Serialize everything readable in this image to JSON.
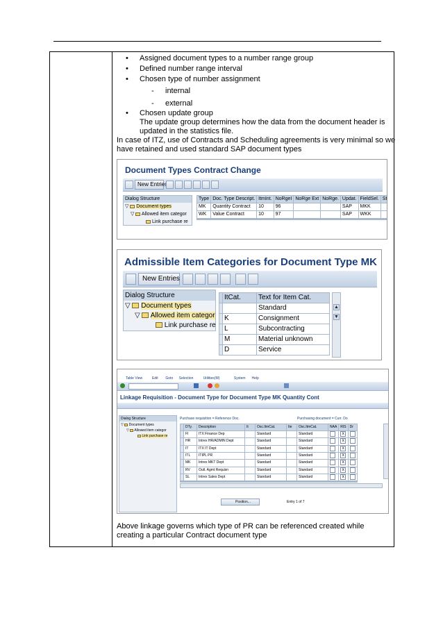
{
  "doc": {
    "bullets": [
      "Assigned document types to a number range group",
      "Defined number range interval",
      "Chosen type of number assignment"
    ],
    "dashes": [
      "internal",
      "external"
    ],
    "bullet4": "Chosen update group",
    "bullet4_line2": "The update group determines how the data from the document header is",
    "bullet4_line3": "updated in the statistics file.",
    "para1_line1": "In case of ITZ, use of Contracts and Scheduling agreements is very minimal so we",
    "para1_line2": "have  retained and used standard SAP document types",
    "footer_line1": "Above linkage governs which type of PR can be referenced created   while",
    "footer_line2": "creating a particular Contract  document type",
    "bullet_glyph": "•",
    "dash_glyph": "-"
  },
  "shot1": {
    "title": "Document Types Contract Change",
    "new_entries": "New Entries",
    "panel_title": "Dialog Structure",
    "tree": [
      "Document types",
      "Allowed item categor",
      "Link purchase re"
    ],
    "columns": [
      "Type",
      "Doc. Type Descript.",
      "ItmInt.",
      "NoRgeI",
      "NoRge Ext",
      "NoRge.",
      "Updat.",
      "FieldSel.",
      "StImI",
      "S"
    ],
    "rows": [
      [
        "MK",
        "Quantity Contract",
        "10",
        "96",
        "",
        "",
        "SAP",
        "MKK",
        "",
        ""
      ],
      [
        "WK",
        "Value Contract",
        "10",
        "97",
        "",
        "",
        "SAP",
        "WKK",
        "",
        ""
      ]
    ]
  },
  "shot2": {
    "title": "Admissible Item Categories for Document Type MK",
    "new_entries": "New Entries",
    "panel_title": "Dialog Structure",
    "tree": [
      "Document types",
      "Allowed item categor",
      "Link purchase re"
    ],
    "columns": [
      "ItCat.",
      "Text for Item Cat."
    ],
    "rows": [
      [
        "",
        "Standard"
      ],
      [
        "K",
        "Consignment"
      ],
      [
        "L",
        "Subcontracting"
      ],
      [
        "M",
        "Material unknown"
      ],
      [
        "D",
        "Service"
      ]
    ]
  },
  "shot3": {
    "menu": [
      "Table View",
      "Edit",
      "Goto",
      "Selection",
      "Utilities(M)",
      "System",
      "Help"
    ],
    "title": "Linkage Requisition - Document Type for Document Type MK Quantity Cont",
    "panel_title": "Dialog Structure",
    "tree": [
      "Document types",
      "Allowed item categor",
      "Link purchase re"
    ],
    "section_left": "Purchase requisition = Reference Doc.",
    "section_right": "Purchasing document = Curr. Do",
    "columns": [
      "DTy.",
      "Description",
      "It",
      "Osc.ItmCat.",
      "Ite",
      "Osc.ItmCat.",
      "NAA",
      "RIS",
      "Dr"
    ],
    "rows": [
      [
        "FI",
        "ITX Finance Dep",
        "",
        "Standard",
        "",
        "Standard",
        "",
        "x",
        ""
      ],
      [
        "HR",
        "Intrex HR/ADMIN Dept",
        "",
        "Standard",
        "",
        "Standard",
        "",
        "x",
        ""
      ],
      [
        "IT",
        "ITX IT Dept",
        "",
        "Standard",
        "",
        "Standard",
        "",
        "x",
        ""
      ],
      [
        "ITL",
        "ITIPL PR",
        "",
        "Standard",
        "",
        "Standard",
        "",
        "x",
        ""
      ],
      [
        "MK",
        "Intrex MKT Dept",
        "",
        "Standard",
        "",
        "Standard",
        "",
        "x",
        ""
      ],
      [
        "RV",
        "Outl. Agmt Requisn",
        "",
        "Standard",
        "",
        "Standard",
        "",
        "x",
        ""
      ],
      [
        "SL",
        "Intrex Sales Dept",
        "",
        "Standard",
        "",
        "Standard",
        "",
        "x",
        ""
      ]
    ],
    "position_button": "Position...",
    "entry_info": "Entry 1 of 7"
  },
  "colors": {
    "sap_title": "#1a3f7a",
    "toolbar": "#c2d1e4",
    "folder": "#f2d774",
    "selected": "#f5e9a8"
  }
}
